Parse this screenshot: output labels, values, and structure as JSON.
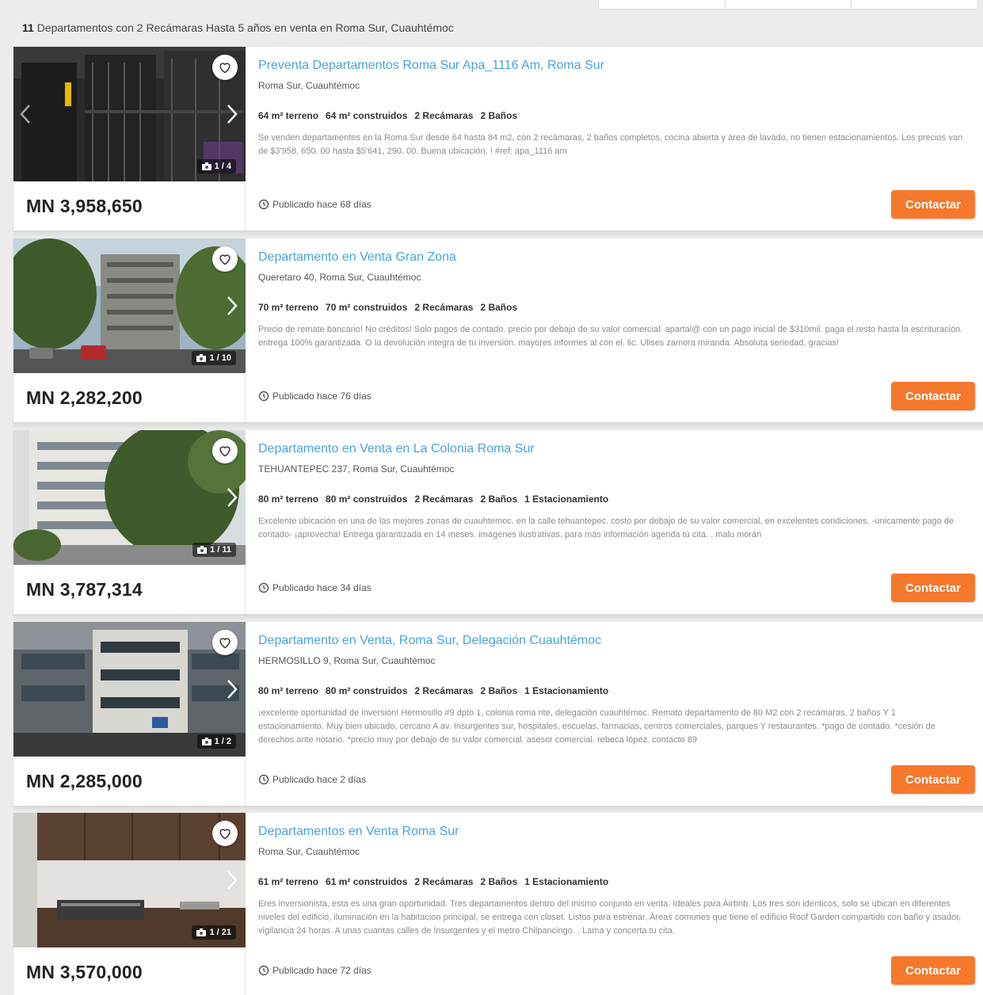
{
  "header": {
    "count": "11",
    "summary": "Departamentos con 2 Recámaras Hasta 5 años en venta en Roma Sur, Cuauhtémoc"
  },
  "colors": {
    "accent": "#f5782d",
    "title_link": "#4aa3d8"
  },
  "listings": [
    {
      "title": "Preventa Departamentos Roma Sur Apa_1116 Am, Roma Sur",
      "location": "Roma Sur, Cuauhtémoc",
      "features": [
        "64 m² terreno",
        "64 m² construidos",
        "2 Recámaras",
        "2 Baños"
      ],
      "description": "Se venden departamentos en la Roma Sur desde 64 hasta 84 m2, con 2 recámaras, 2 baños completos, cocina abierta y área de lavado, no tienen estacionamientos. Los precios van de $3'958, 650. 00 hasta $5'641, 290. 00. Buena ubicación. ! #ref: apa_1116 am",
      "price": "MN 3,958,650",
      "published": "Publicado hace 68 días",
      "photo_counter": "1 / 4",
      "contact_label": "Contactar"
    },
    {
      "title": "Departamento en Venta Gran Zona",
      "location": "Queretaro 40, Roma Sur, Cuauhtémoc",
      "features": [
        "70 m² terreno",
        "70 m² construidos",
        "2 Recámaras",
        "2 Baños"
      ],
      "description": "Precio de remate bancario! No créditos! Solo pagos de contado. precio por debajo de su valor comercial. apartal@ con un pago inicial de $310mil. paga el resto hasta la escrituración. entrega 100% garantizada. O la devolución integra de tu inversión. mayores informes al con el. lic. Ulises zamora miranda. Absoluta seriedad, gracias!",
      "price": "MN 2,282,200",
      "published": "Publicado hace 76 días",
      "photo_counter": "1 / 10",
      "contact_label": "Contactar"
    },
    {
      "title": "Departamento en Venta en La Colonia Roma Sur",
      "location": "TEHUANTEPEC 237, Roma Sur, Cuauhtémoc",
      "features": [
        "80 m² terreno",
        "80 m² construidos",
        "2 Recámaras",
        "2 Baños",
        "1 Estacionamiento"
      ],
      "description": "Excelente ubicación en una de las mejores zonas de cuauhtemoc. en la calle tehuantepec. costo por debajo de su valor comercial, en excelentes condiciones. -unicamente pago de contado- ¡aprovecha! Entrega garantizada en 14 meses. imágenes ilustrativas. para más información agenda tú cita. . malu morán",
      "price": "MN 3,787,314",
      "published": "Publicado hace 34 días",
      "photo_counter": "1 / 11",
      "contact_label": "Contactar"
    },
    {
      "title": "Departamento en Venta, Roma Sur, Delegación Cuauhtémoc",
      "location": "HERMOSILLO 9, Roma Sur, Cuauhtémoc",
      "features": [
        "80 m² terreno",
        "80 m² construidos",
        "2 Recámaras",
        "2 Baños",
        "1 Estacionamiento"
      ],
      "description": "¡excelente oportunidad de inversión! Hermosillo #9 dpto 1, colonia roma nte, delegación cuauhtémoc. Remato departamento de 80 M2 con 2 recámaras, 2 baños Y 1 estacionamiento. Muy bien ubicado, cercano A av. Insurgentes sur, hospitales, escuelas, farmacias, centros comerciales, parques Y restaurantes. *pago de contado. *cesión de derechos ante notario. *precio muy por debajo de su valor comercial. asesor comercial. rebeca lópez. contacto 89",
      "price": "MN 2,285,000",
      "published": "Publicado hace 2 días",
      "photo_counter": "1 / 2",
      "contact_label": "Contactar"
    },
    {
      "title": "Departamentos en Venta Roma Sur",
      "location": "Roma Sur, Cuauhtémoc",
      "features": [
        "61 m² terreno",
        "61 m² construidos",
        "2 Recámaras",
        "2 Baños",
        "1 Estacionamiento"
      ],
      "description": "Eres inversionista, esta es una gran oportunidad. Tres departamentos dentro del mismo conjunto en venta. Ideales para Airbnb. Los tres son identicos, solo se ubican en diferentes niveles del edificio, iluminación en la habitacion principal, se entrega con closet. Listos para estrenar. Áreas comunes que tiene el edificio Roof Garden compartido con baño y asador, vigilancia 24 horas. A unas cuantas calles de Insurgentes y el metro Chilpancingo. . Lama y concerta tu cita.",
      "price": "MN 3,570,000",
      "published": "Publicado hace 72 días",
      "photo_counter": "1 / 21",
      "contact_label": "Contactar"
    }
  ]
}
